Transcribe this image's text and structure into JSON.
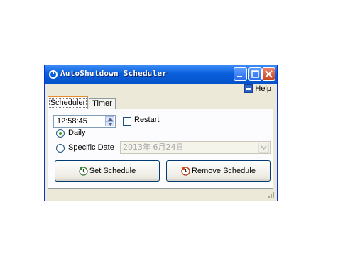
{
  "window": {
    "title": "AutoShutdown Scheduler"
  },
  "menu": {
    "help_label": "Help"
  },
  "tabs": [
    {
      "label": "Scheduler",
      "active": true
    },
    {
      "label": "Timer",
      "active": false
    }
  ],
  "scheduler": {
    "time_value": "12:58:45",
    "restart_label": "Restart",
    "restart_checked": false,
    "daily_label": "Daily",
    "daily_selected": true,
    "specific_date_label": "Specific Date",
    "specific_date_selected": false,
    "date_value": "2013年 6月24日",
    "set_schedule_label": "Set Schedule",
    "remove_schedule_label": "Remove Schedule"
  },
  "icons": {
    "app": "shutdown-icon",
    "help": "help-book-icon",
    "set": "clock-icon",
    "remove": "clock-remove-icon"
  },
  "colors": {
    "titlebar": "#0a5fdc",
    "window_bg": "#ece9d8",
    "tab_accent": "#e68b2c",
    "close_button": "#c8441c"
  }
}
